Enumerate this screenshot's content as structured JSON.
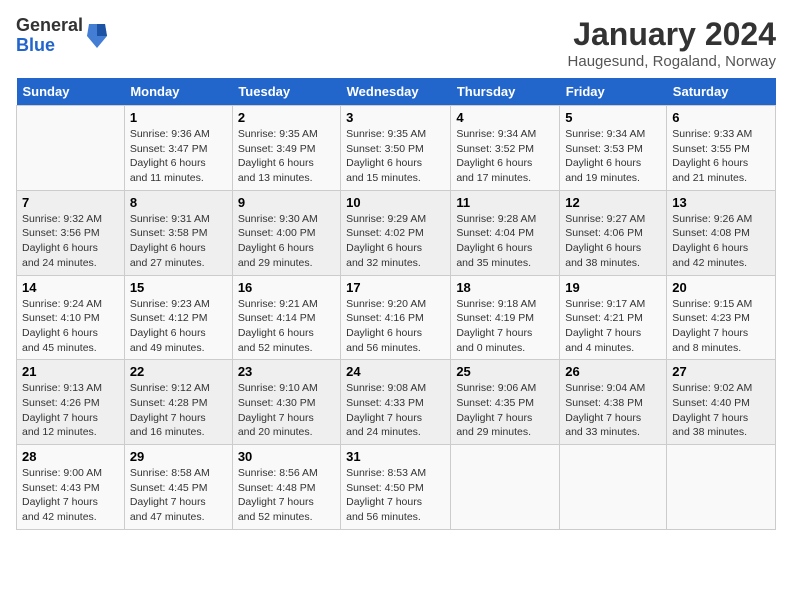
{
  "header": {
    "logo_general": "General",
    "logo_blue": "Blue",
    "month_title": "January 2024",
    "subtitle": "Haugesund, Rogaland, Norway"
  },
  "calendar": {
    "days_of_week": [
      "Sunday",
      "Monday",
      "Tuesday",
      "Wednesday",
      "Thursday",
      "Friday",
      "Saturday"
    ],
    "weeks": [
      [
        {
          "day": "",
          "info": ""
        },
        {
          "day": "1",
          "info": "Sunrise: 9:36 AM\nSunset: 3:47 PM\nDaylight: 6 hours\nand 11 minutes."
        },
        {
          "day": "2",
          "info": "Sunrise: 9:35 AM\nSunset: 3:49 PM\nDaylight: 6 hours\nand 13 minutes."
        },
        {
          "day": "3",
          "info": "Sunrise: 9:35 AM\nSunset: 3:50 PM\nDaylight: 6 hours\nand 15 minutes."
        },
        {
          "day": "4",
          "info": "Sunrise: 9:34 AM\nSunset: 3:52 PM\nDaylight: 6 hours\nand 17 minutes."
        },
        {
          "day": "5",
          "info": "Sunrise: 9:34 AM\nSunset: 3:53 PM\nDaylight: 6 hours\nand 19 minutes."
        },
        {
          "day": "6",
          "info": "Sunrise: 9:33 AM\nSunset: 3:55 PM\nDaylight: 6 hours\nand 21 minutes."
        }
      ],
      [
        {
          "day": "7",
          "info": "Sunrise: 9:32 AM\nSunset: 3:56 PM\nDaylight: 6 hours\nand 24 minutes."
        },
        {
          "day": "8",
          "info": "Sunrise: 9:31 AM\nSunset: 3:58 PM\nDaylight: 6 hours\nand 27 minutes."
        },
        {
          "day": "9",
          "info": "Sunrise: 9:30 AM\nSunset: 4:00 PM\nDaylight: 6 hours\nand 29 minutes."
        },
        {
          "day": "10",
          "info": "Sunrise: 9:29 AM\nSunset: 4:02 PM\nDaylight: 6 hours\nand 32 minutes."
        },
        {
          "day": "11",
          "info": "Sunrise: 9:28 AM\nSunset: 4:04 PM\nDaylight: 6 hours\nand 35 minutes."
        },
        {
          "day": "12",
          "info": "Sunrise: 9:27 AM\nSunset: 4:06 PM\nDaylight: 6 hours\nand 38 minutes."
        },
        {
          "day": "13",
          "info": "Sunrise: 9:26 AM\nSunset: 4:08 PM\nDaylight: 6 hours\nand 42 minutes."
        }
      ],
      [
        {
          "day": "14",
          "info": "Sunrise: 9:24 AM\nSunset: 4:10 PM\nDaylight: 6 hours\nand 45 minutes."
        },
        {
          "day": "15",
          "info": "Sunrise: 9:23 AM\nSunset: 4:12 PM\nDaylight: 6 hours\nand 49 minutes."
        },
        {
          "day": "16",
          "info": "Sunrise: 9:21 AM\nSunset: 4:14 PM\nDaylight: 6 hours\nand 52 minutes."
        },
        {
          "day": "17",
          "info": "Sunrise: 9:20 AM\nSunset: 4:16 PM\nDaylight: 6 hours\nand 56 minutes."
        },
        {
          "day": "18",
          "info": "Sunrise: 9:18 AM\nSunset: 4:19 PM\nDaylight: 7 hours\nand 0 minutes."
        },
        {
          "day": "19",
          "info": "Sunrise: 9:17 AM\nSunset: 4:21 PM\nDaylight: 7 hours\nand 4 minutes."
        },
        {
          "day": "20",
          "info": "Sunrise: 9:15 AM\nSunset: 4:23 PM\nDaylight: 7 hours\nand 8 minutes."
        }
      ],
      [
        {
          "day": "21",
          "info": "Sunrise: 9:13 AM\nSunset: 4:26 PM\nDaylight: 7 hours\nand 12 minutes."
        },
        {
          "day": "22",
          "info": "Sunrise: 9:12 AM\nSunset: 4:28 PM\nDaylight: 7 hours\nand 16 minutes."
        },
        {
          "day": "23",
          "info": "Sunrise: 9:10 AM\nSunset: 4:30 PM\nDaylight: 7 hours\nand 20 minutes."
        },
        {
          "day": "24",
          "info": "Sunrise: 9:08 AM\nSunset: 4:33 PM\nDaylight: 7 hours\nand 24 minutes."
        },
        {
          "day": "25",
          "info": "Sunrise: 9:06 AM\nSunset: 4:35 PM\nDaylight: 7 hours\nand 29 minutes."
        },
        {
          "day": "26",
          "info": "Sunrise: 9:04 AM\nSunset: 4:38 PM\nDaylight: 7 hours\nand 33 minutes."
        },
        {
          "day": "27",
          "info": "Sunrise: 9:02 AM\nSunset: 4:40 PM\nDaylight: 7 hours\nand 38 minutes."
        }
      ],
      [
        {
          "day": "28",
          "info": "Sunrise: 9:00 AM\nSunset: 4:43 PM\nDaylight: 7 hours\nand 42 minutes."
        },
        {
          "day": "29",
          "info": "Sunrise: 8:58 AM\nSunset: 4:45 PM\nDaylight: 7 hours\nand 47 minutes."
        },
        {
          "day": "30",
          "info": "Sunrise: 8:56 AM\nSunset: 4:48 PM\nDaylight: 7 hours\nand 52 minutes."
        },
        {
          "day": "31",
          "info": "Sunrise: 8:53 AM\nSunset: 4:50 PM\nDaylight: 7 hours\nand 56 minutes."
        },
        {
          "day": "",
          "info": ""
        },
        {
          "day": "",
          "info": ""
        },
        {
          "day": "",
          "info": ""
        }
      ]
    ]
  }
}
